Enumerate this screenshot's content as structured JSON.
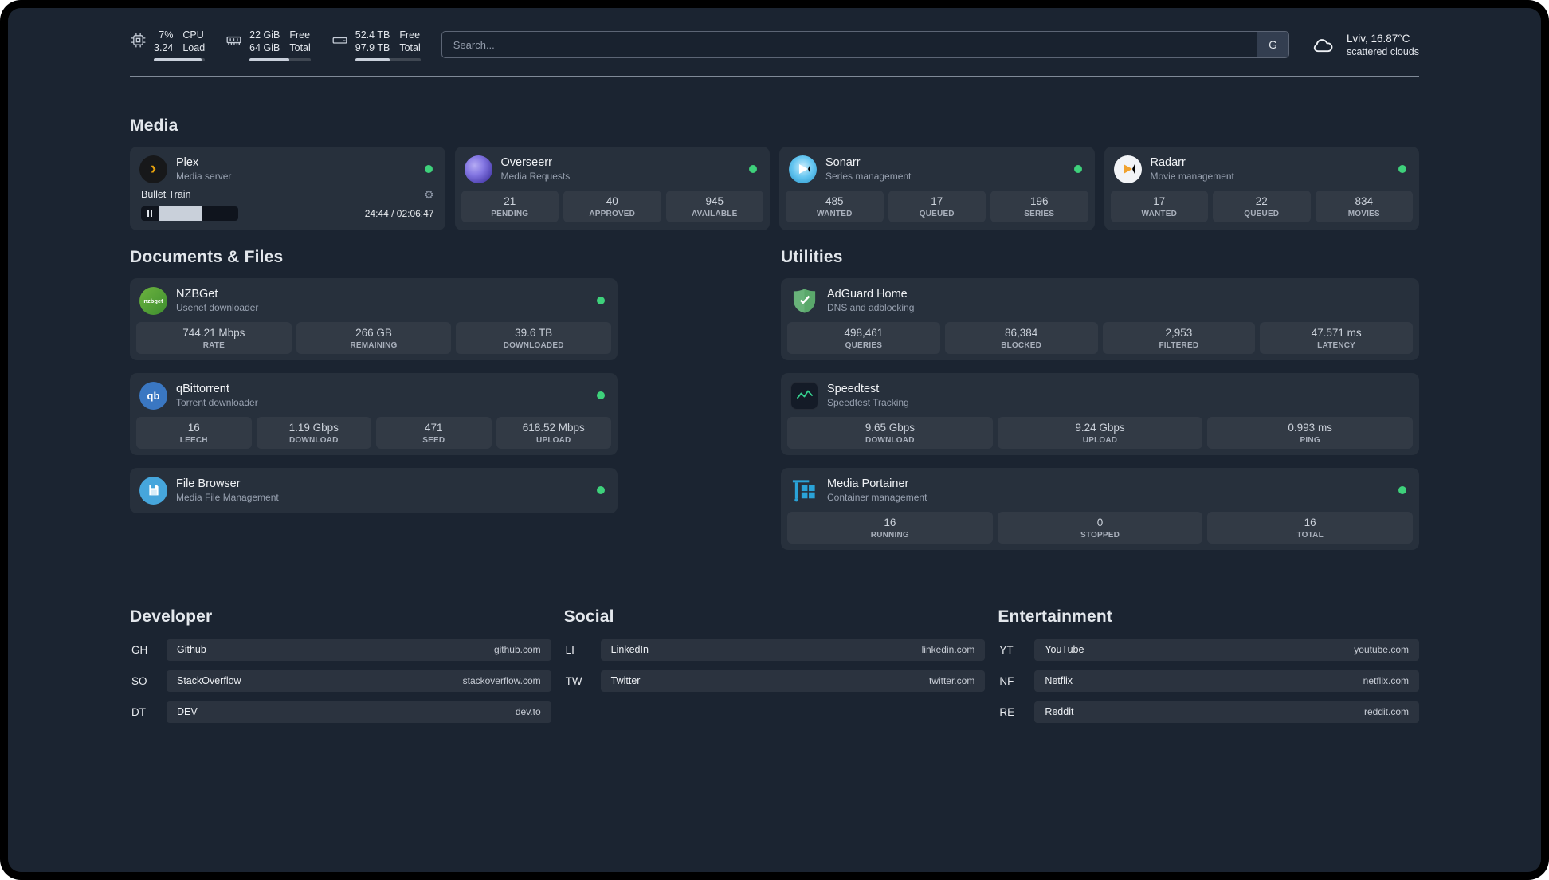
{
  "topbar": {
    "cpu": {
      "value1": "7%",
      "value2": "3.24",
      "label1": "CPU",
      "label2": "Load",
      "bar_pct": 93
    },
    "memory": {
      "value1": "22 GiB",
      "value2": "64 GiB",
      "label1": "Free",
      "label2": "Total",
      "bar_pct": 65
    },
    "disk": {
      "value1": "52.4 TB",
      "value2": "97.9 TB",
      "label1": "Free",
      "label2": "Total",
      "bar_pct": 53
    },
    "search": {
      "placeholder": "Search...",
      "provider": "G"
    },
    "weather": {
      "location": "Lviv, 16.87°C",
      "condition": "scattered clouds"
    }
  },
  "media": {
    "title": "Media",
    "plex": {
      "name": "Plex",
      "desc": "Media server",
      "now_playing": "Bullet Train",
      "time": "24:44 / 02:06:47",
      "progress_pct": 55
    },
    "overseerr": {
      "name": "Overseerr",
      "desc": "Media Requests",
      "stats": [
        {
          "value": "21",
          "label": "PENDING"
        },
        {
          "value": "40",
          "label": "APPROVED"
        },
        {
          "value": "945",
          "label": "AVAILABLE"
        }
      ]
    },
    "sonarr": {
      "name": "Sonarr",
      "desc": "Series management",
      "stats": [
        {
          "value": "485",
          "label": "WANTED"
        },
        {
          "value": "17",
          "label": "QUEUED"
        },
        {
          "value": "196",
          "label": "SERIES"
        }
      ]
    },
    "radarr": {
      "name": "Radarr",
      "desc": "Movie management",
      "stats": [
        {
          "value": "17",
          "label": "WANTED"
        },
        {
          "value": "22",
          "label": "QUEUED"
        },
        {
          "value": "834",
          "label": "MOVIES"
        }
      ]
    }
  },
  "documents": {
    "title": "Documents & Files",
    "nzbget": {
      "name": "NZBGet",
      "desc": "Usenet downloader",
      "stats": [
        {
          "value": "744.21 Mbps",
          "label": "RATE"
        },
        {
          "value": "266 GB",
          "label": "REMAINING"
        },
        {
          "value": "39.6 TB",
          "label": "DOWNLOADED"
        }
      ]
    },
    "qbittorrent": {
      "name": "qBittorrent",
      "desc": "Torrent downloader",
      "stats": [
        {
          "value": "16",
          "label": "LEECH"
        },
        {
          "value": "1.19 Gbps",
          "label": "DOWNLOAD"
        },
        {
          "value": "471",
          "label": "SEED"
        },
        {
          "value": "618.52 Mbps",
          "label": "UPLOAD"
        }
      ]
    },
    "filebrowser": {
      "name": "File Browser",
      "desc": "Media File Management"
    }
  },
  "utilities": {
    "title": "Utilities",
    "adguard": {
      "name": "AdGuard Home",
      "desc": "DNS and adblocking",
      "stats": [
        {
          "value": "498,461",
          "label": "QUERIES"
        },
        {
          "value": "86,384",
          "label": "BLOCKED"
        },
        {
          "value": "2,953",
          "label": "FILTERED"
        },
        {
          "value": "47.571 ms",
          "label": "LATENCY"
        }
      ]
    },
    "speedtest": {
      "name": "Speedtest",
      "desc": "Speedtest Tracking",
      "stats": [
        {
          "value": "9.65 Gbps",
          "label": "DOWNLOAD"
        },
        {
          "value": "9.24 Gbps",
          "label": "UPLOAD"
        },
        {
          "value": "0.993 ms",
          "label": "PING"
        }
      ]
    },
    "portainer": {
      "name": "Media Portainer",
      "desc": "Container management",
      "stats": [
        {
          "value": "16",
          "label": "RUNNING"
        },
        {
          "value": "0",
          "label": "STOPPED"
        },
        {
          "value": "16",
          "label": "TOTAL"
        }
      ]
    }
  },
  "bookmarks": {
    "developer": {
      "title": "Developer",
      "items": [
        {
          "abbr": "GH",
          "name": "Github",
          "domain": "github.com"
        },
        {
          "abbr": "SO",
          "name": "StackOverflow",
          "domain": "stackoverflow.com"
        },
        {
          "abbr": "DT",
          "name": "DEV",
          "domain": "dev.to"
        }
      ]
    },
    "social": {
      "title": "Social",
      "items": [
        {
          "abbr": "LI",
          "name": "LinkedIn",
          "domain": "linkedin.com"
        },
        {
          "abbr": "TW",
          "name": "Twitter",
          "domain": "twitter.com"
        }
      ]
    },
    "entertainment": {
      "title": "Entertainment",
      "items": [
        {
          "abbr": "YT",
          "name": "YouTube",
          "domain": "youtube.com"
        },
        {
          "abbr": "NF",
          "name": "Netflix",
          "domain": "netflix.com"
        },
        {
          "abbr": "RE",
          "name": "Reddit",
          "domain": "reddit.com"
        }
      ]
    }
  },
  "icons": {
    "nzbget_text": "nzbget",
    "qbittorrent_text": "qb"
  },
  "colors": {
    "status_online": "#3ed17b",
    "background": "#1b2431",
    "card": "rgba(255,255,255,0.055)"
  }
}
